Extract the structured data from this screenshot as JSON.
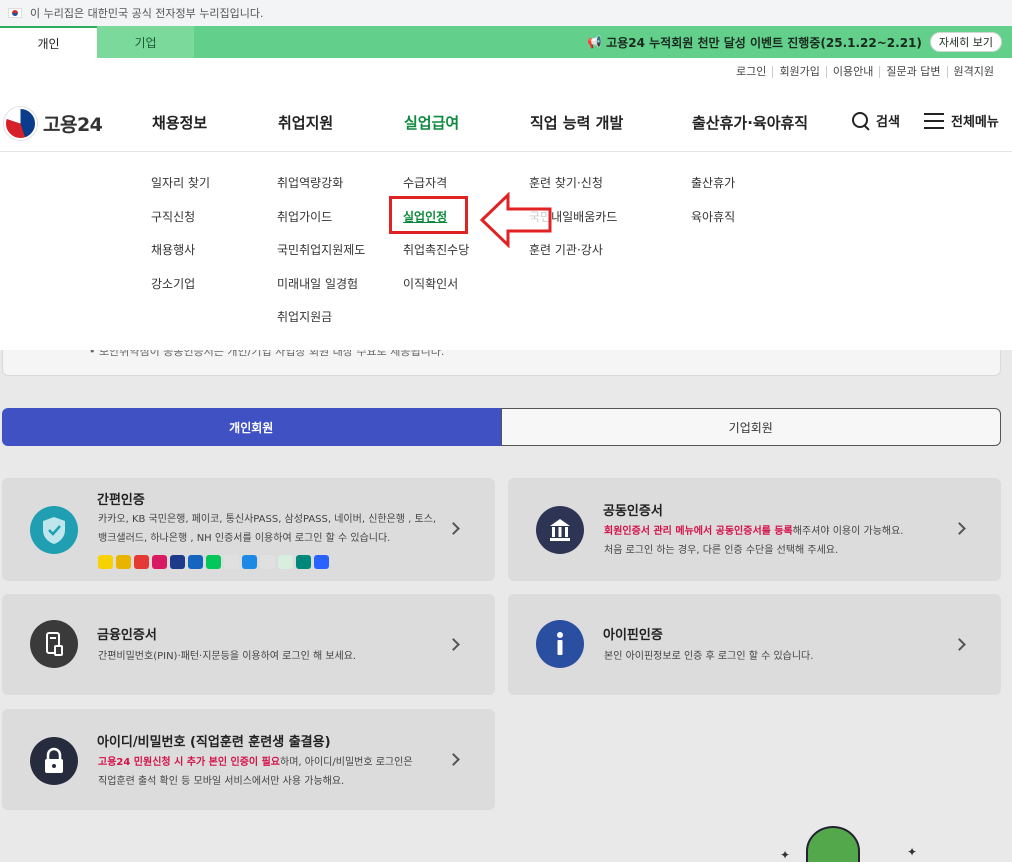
{
  "gov_banner": {
    "text": "이 누리집은 대한민국 공식 전자정부 누리집입니다."
  },
  "user_tabs": [
    "개인",
    "기업"
  ],
  "event": {
    "text": "고용24 누적회원 천만 달성 이벤트 진행중(25.1.22~2.21)",
    "button": "자세히 보기"
  },
  "util_links": [
    "로그인",
    "회원가입",
    "이용안내",
    "질문과 답변",
    "원격지원"
  ],
  "logo": {
    "text": "고용24"
  },
  "gnb": {
    "menus": [
      "채용정보",
      "취업지원",
      "실업급여",
      "직업 능력 개발",
      "출산휴가·육아휴직"
    ],
    "search": "검색",
    "all_menu": "전체메뉴"
  },
  "submenus": {
    "col1": [
      "일자리 찾기",
      "구직신청",
      "채용행사",
      "강소기업"
    ],
    "col2": [
      "취업역량강화",
      "취업가이드",
      "국민취업지원제도",
      "미래내일 일경험",
      "취업지원금"
    ],
    "col3": [
      "수급자격",
      "실업인정",
      "취업촉진수당",
      "이직확인서"
    ],
    "col4": [
      "훈련 찾기·신청",
      "국민내일배움카드",
      "훈련 기관·강사"
    ],
    "col5": [
      "출산휴가",
      "육아휴직"
    ]
  },
  "notice": {
    "text": "• 보안취약점이 공동인증서는 개인/기업 사업장 회원 대상 수요로 제공됩니다."
  },
  "member_tabs": [
    "개인회원",
    "기업회원"
  ],
  "cards": {
    "simple": {
      "title": "간편인증",
      "desc1": "카카오, KB 국민은행, 페이코, 통신사PASS, 삼성PASS, 네이버, 신한은행 , 토스,",
      "desc2": "뱅크샐러드, 하나은행 , NH 인증서를 이용하여 로그인 할 수 있습니다."
    },
    "joint": {
      "title": "공동인증서",
      "desc1_red": "회원인증서 관리 메뉴에서 공동인증서를 등록",
      "desc1_rest": "해주셔야 이용이 가능해요.",
      "desc2": "처음 로그인 하는 경우, 다른 인증 수단을 선택해 주세요."
    },
    "finance": {
      "title": "금융인증서",
      "desc": "간편비밀번호(PIN)·패턴·지문등을 이용하여 로그인 해 보세요."
    },
    "ipin": {
      "title": "아이핀인증",
      "desc": "본인 아이핀정보로 인증 후 로그인 할 수 있습니다."
    },
    "idpw": {
      "title": "아이디/비밀번호 (직업훈련 훈련생 출결용)",
      "desc1_red": "고용24 민원신청 시 추가 본인 인증이 필요",
      "desc1_rest": "하며, 아이디/비밀번호 로그인은",
      "desc2": "직업훈련 출석 확인 등 모바일 서비스에서만 사용 가능해요."
    }
  },
  "colors": {
    "accent_green": "#0e8a3e",
    "member_tab_blue": "#4052c3",
    "highlight_red": "#e02222"
  }
}
